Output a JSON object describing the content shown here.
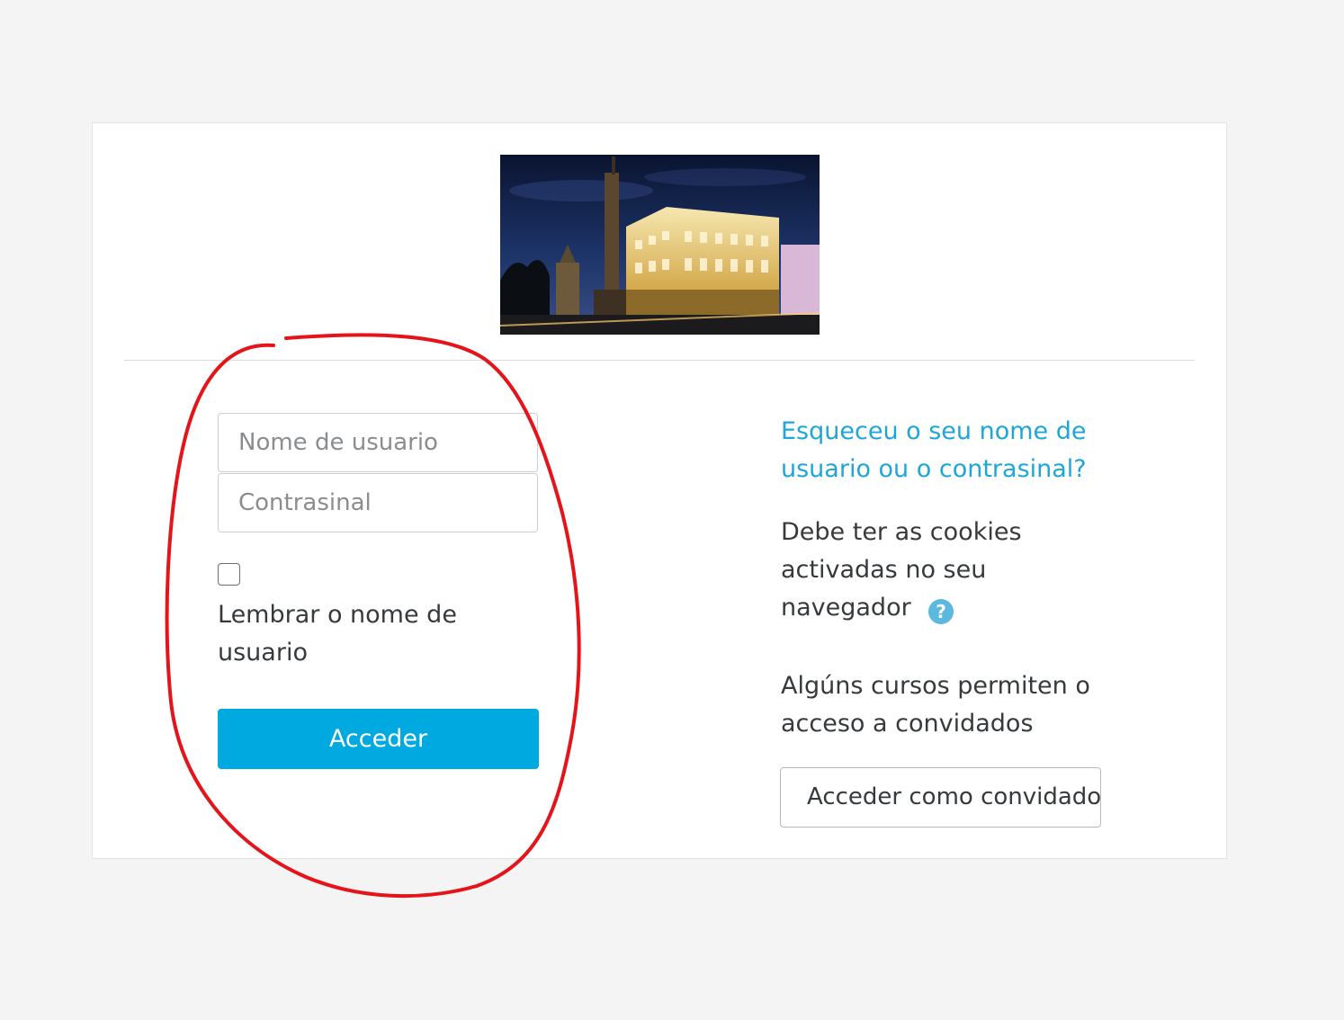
{
  "login": {
    "username_placeholder": "Nome de usuario",
    "password_placeholder": "Contrasinal",
    "remember_label": "Lembrar o nome de usuario",
    "submit_label": "Acceder"
  },
  "info": {
    "forgot_link": "Esqueceu o seu nome de usuario ou o contrasinal?",
    "cookies_text": "Debe ter as cookies activadas no seu navegador",
    "help_icon": "?",
    "guest_text": "Algúns cursos permiten o acceso a convidados",
    "guest_button": "Acceder como convidado"
  },
  "colors": {
    "primary": "#00a9df",
    "link": "#1ea6d8",
    "annotation": "#e5141b"
  },
  "icons": {
    "help": "question-circle-icon",
    "logo": "building-night-photo"
  }
}
